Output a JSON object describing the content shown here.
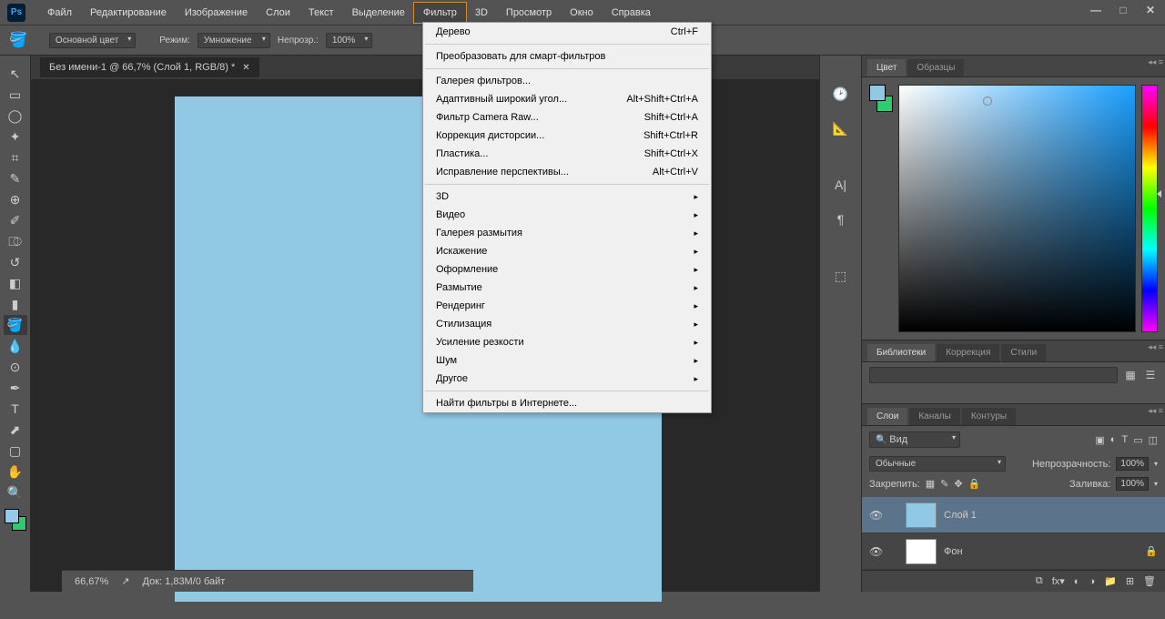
{
  "app": {
    "logo": "Ps"
  },
  "menubar": [
    "Файл",
    "Редактирование",
    "Изображение",
    "Слои",
    "Текст",
    "Выделение",
    "Фильтр",
    "3D",
    "Просмотр",
    "Окно",
    "Справка"
  ],
  "active_menu_index": 6,
  "optionsbar": {
    "fill_label": "Основной цвет",
    "mode_label": "Режим:",
    "mode_value": "Умножение",
    "opacity_label": "Непрозр.:",
    "opacity_value": "100%"
  },
  "doc_tab": "Без имени-1 @ 66,7% (Слой 1, RGB/8) *",
  "dropdown": {
    "sections": [
      [
        {
          "label": "Дерево",
          "shortcut": "Ctrl+F"
        }
      ],
      [
        {
          "label": "Преобразовать для смарт-фильтров"
        }
      ],
      [
        {
          "label": "Галерея фильтров..."
        },
        {
          "label": "Адаптивный широкий угол...",
          "shortcut": "Alt+Shift+Ctrl+A"
        },
        {
          "label": "Фильтр Camera Raw...",
          "shortcut": "Shift+Ctrl+A"
        },
        {
          "label": "Коррекция дисторсии...",
          "shortcut": "Shift+Ctrl+R"
        },
        {
          "label": "Пластика...",
          "shortcut": "Shift+Ctrl+X"
        },
        {
          "label": "Исправление перспективы...",
          "shortcut": "Alt+Ctrl+V"
        }
      ],
      [
        {
          "label": "3D",
          "sub": true
        },
        {
          "label": "Видео",
          "sub": true
        },
        {
          "label": "Галерея размытия",
          "sub": true
        },
        {
          "label": "Искажение",
          "sub": true
        },
        {
          "label": "Оформление",
          "sub": true
        },
        {
          "label": "Размытие",
          "sub": true
        },
        {
          "label": "Рендеринг",
          "sub": true
        },
        {
          "label": "Стилизация",
          "sub": true
        },
        {
          "label": "Усиление резкости",
          "sub": true
        },
        {
          "label": "Шум",
          "sub": true
        },
        {
          "label": "Другое",
          "sub": true
        }
      ],
      [
        {
          "label": "Найти фильтры в Интернете..."
        }
      ]
    ]
  },
  "panels": {
    "color_tabs": [
      "Цвет",
      "Образцы"
    ],
    "lib_tabs": [
      "Библиотеки",
      "Коррекция",
      "Стили"
    ],
    "layer_tabs": [
      "Слои",
      "Каналы",
      "Контуры"
    ],
    "layers": {
      "kind_label": "Вид",
      "blend_mode": "Обычные",
      "opacity_label": "Непрозрачность:",
      "opacity_value": "100%",
      "lock_label": "Закрепить:",
      "fill_label": "Заливка:",
      "fill_value": "100%",
      "items": [
        {
          "name": "Слой 1",
          "thumb": "#91c8e4",
          "selected": true,
          "locked": false
        },
        {
          "name": "Фон",
          "thumb": "#ffffff",
          "selected": false,
          "locked": true
        }
      ]
    }
  },
  "status": {
    "zoom": "66,67%",
    "doc": "Док: 1,83M/0 байт"
  }
}
